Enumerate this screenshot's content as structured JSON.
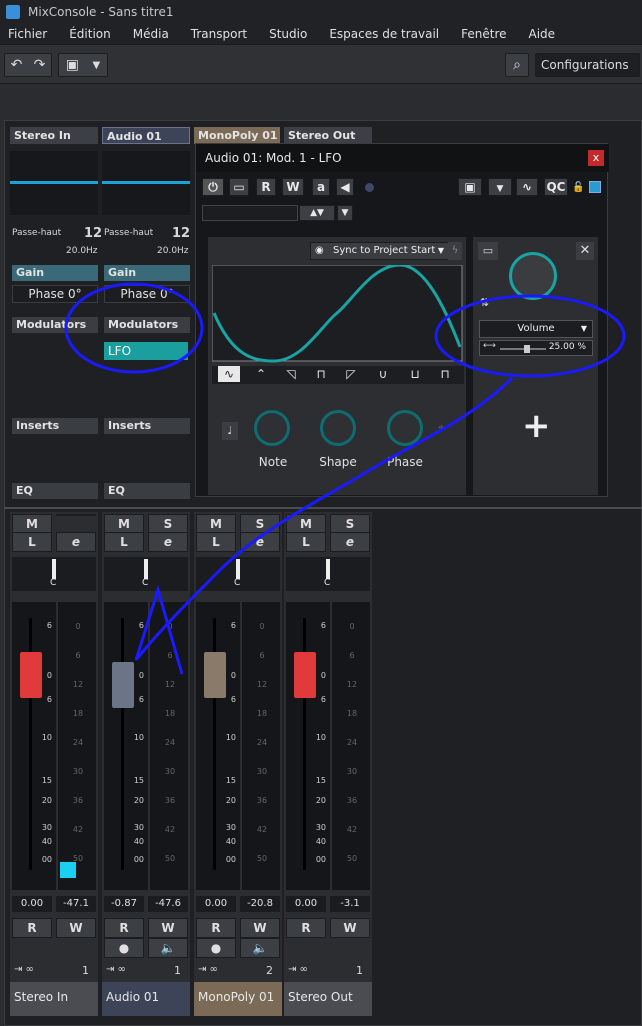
{
  "window": {
    "title": "MixConsole - Sans titre1"
  },
  "menu": [
    "Fichier",
    "Édition",
    "Média",
    "Transport",
    "Studio",
    "Espaces de travail",
    "Fenêtre",
    "Aide"
  ],
  "toolbar": {
    "configurations": "Configurations"
  },
  "channels": [
    {
      "name": "Stereo In",
      "bottom": "Stereo In",
      "number": "1",
      "filter_label": "Passe-haut",
      "filter_value": "20.0Hz",
      "gain": "Gain",
      "phase": "Phase 0°",
      "modulators": "Modulators",
      "inserts": "Inserts",
      "eq": "EQ",
      "pan": "C",
      "fader_val": "0.00",
      "meter_val": "-47.1",
      "cap_color": "#e03a3a",
      "mute": "M",
      "listen": "L",
      "edit": "e",
      "read": "R",
      "write": "W"
    },
    {
      "name": "Audio 01",
      "bottom": "Audio 01",
      "number": "1",
      "filter_label": "Passe-haut",
      "filter_value": "20.0Hz",
      "gain": "Gain",
      "phase": "Phase 0°",
      "modulators": "Modulators",
      "lfo": "LFO",
      "inserts": "Inserts",
      "eq": "EQ",
      "pan": "C",
      "fader_val": "-0.87",
      "meter_val": "-47.6",
      "cap_color": "#6c7488",
      "mute": "M",
      "solo": "S",
      "listen": "L",
      "edit": "e",
      "read": "R",
      "write": "W"
    },
    {
      "name": "MonoPoly 01",
      "bottom": "MonoPoly 01",
      "number": "2",
      "pan": "C",
      "fader_val": "0.00",
      "meter_val": "-20.8",
      "cap_color": "#8a7a6a",
      "mute": "M",
      "solo": "S",
      "listen": "L",
      "edit": "e",
      "read": "R",
      "write": "W"
    },
    {
      "name": "Stereo Out",
      "bottom": "Stereo Out",
      "number": "1",
      "pan": "C",
      "fader_val": "0.00",
      "meter_val": "-3.1",
      "cap_color": "#e03a3a",
      "mute": "M",
      "solo": "S",
      "listen": "L",
      "edit": "e",
      "read": "R",
      "write": "W"
    }
  ],
  "fader_scale": [
    "6",
    "0",
    "6",
    "10",
    "15",
    "20",
    "30",
    "40",
    "00"
  ],
  "meter_scale": [
    "0",
    "6",
    "12",
    "18",
    "24",
    "30",
    "36",
    "42",
    "50"
  ],
  "lfo": {
    "title": "Audio 01: Mod. 1 - LFO",
    "close": "x",
    "r": "R",
    "w": "W",
    "a": "a",
    "qc": "QC",
    "sync": "Sync to Project Start",
    "knobs": [
      "Note",
      "Shape",
      "Phase"
    ],
    "target": "Volume",
    "amount": "25.00 %",
    "amount_fraction": 0.25,
    "plus": "+"
  },
  "accent": "#1aa3a3"
}
